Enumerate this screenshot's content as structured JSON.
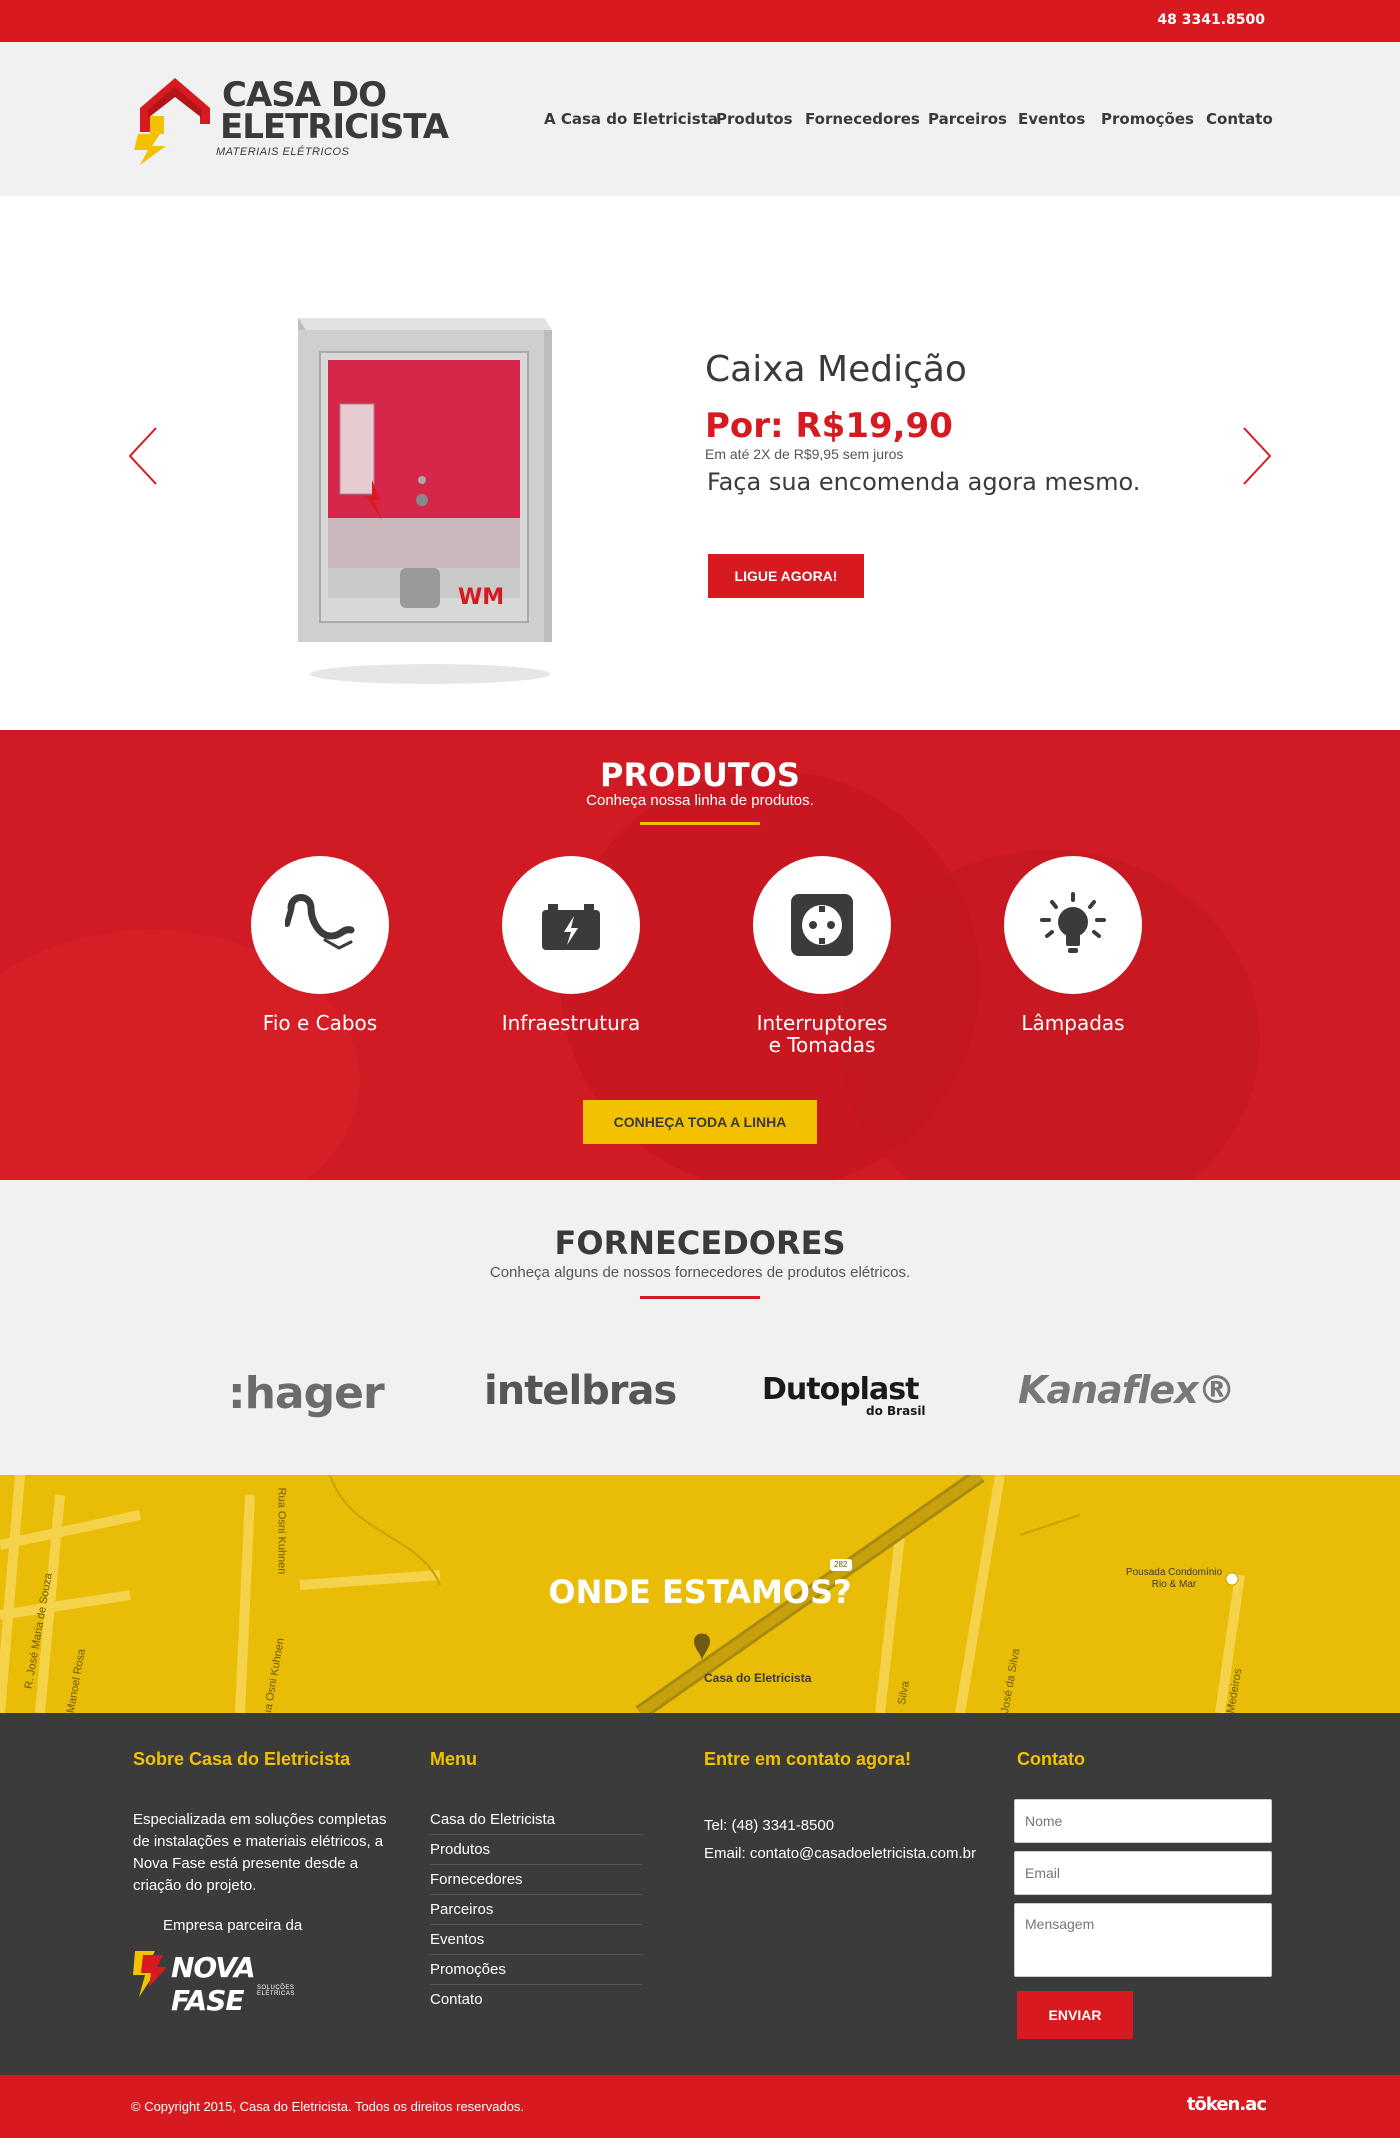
{
  "topbar": {
    "phone": "48 3341.8500"
  },
  "header": {
    "logo_line1": "CASA DO",
    "logo_line2": "ELETRICISTA",
    "logo_sub": "MATERIAIS ELÉTRICOS",
    "nav": [
      "A Casa do Eletricista",
      "Produtos",
      "Fornecedores",
      "Parceiros",
      "Eventos",
      "Promoções",
      "Contato"
    ]
  },
  "hero": {
    "title": "Caixa Medição",
    "price": "Por: R$19,90",
    "installments": "Em até 2X de R$9,95 sem juros",
    "cta_text": "Faça sua encomenda agora mesmo.",
    "button": "LIGUE AGORA!",
    "product_brand": "WM"
  },
  "produtos": {
    "title": "PRODUTOS",
    "subtitle": "Conheça nossa linha de produtos.",
    "categories": [
      {
        "label": "Fio e Cabos",
        "icon": "cable-icon"
      },
      {
        "label": "Infraestrutura",
        "icon": "battery-icon"
      },
      {
        "label": "Interruptores\ne Tomadas",
        "icon": "outlet-icon"
      },
      {
        "label": "Lâmpadas",
        "icon": "lightbulb-icon"
      }
    ],
    "button": "CONHEÇA TODA A LINHA"
  },
  "fornecedores": {
    "title": "FORNECEDORES",
    "subtitle": "Conheça alguns de nossos fornecedores de produtos elétricos.",
    "brands": [
      ":hager",
      "intelbras",
      "Dutoplast",
      "Kanaflex®"
    ],
    "dutoplast_sub": "do Brasil"
  },
  "map": {
    "title": "ONDE ESTAMOS?",
    "pin_label": "Casa do Eletricista",
    "poi_label": "Pousada Condomínio Rio & Mar",
    "streets": [
      "R. José Maria de Souza",
      "Rua Osni Kuhnen",
      "Rua Osni Kuhnen",
      "Manoel Rosa",
      "Silva",
      "José da Silva",
      "Medeiros",
      "282"
    ]
  },
  "footer": {
    "about_title": "Sobre Casa do Eletricista",
    "about_text": "Especializada em soluções completas de instalações e materiais elétricos, a Nova Fase está presente desde a criação do projeto.",
    "partner_text": "Empresa parceira da",
    "partner_logo": "NOVA FASE",
    "partner_logo_sub": "SOLUÇÕES ELÉTRICAS",
    "menu_title": "Menu",
    "menu_items": [
      "Casa do Eletricista",
      "Produtos",
      "Fornecedores",
      "Parceiros",
      "Eventos",
      "Promoções",
      "Contato"
    ],
    "contact_title": "Entre em contato agora!",
    "phone": "Tel: (48) 3341-8500",
    "email": "Email: contato@casadoeletricista.com.br",
    "form_title": "Contato",
    "form": {
      "name_placeholder": "Nome",
      "email_placeholder": "Email",
      "message_placeholder": "Mensagem",
      "submit": "ENVIAR"
    }
  },
  "copyright": {
    "text": "© Copyright 2015, Casa do Eletricista. Todos os direitos reservados.",
    "agency": "tōken.ac"
  },
  "colors": {
    "red": "#d71920",
    "yellow": "#f2c200",
    "dark": "#3b3b3c",
    "light": "#f1f1f1"
  }
}
